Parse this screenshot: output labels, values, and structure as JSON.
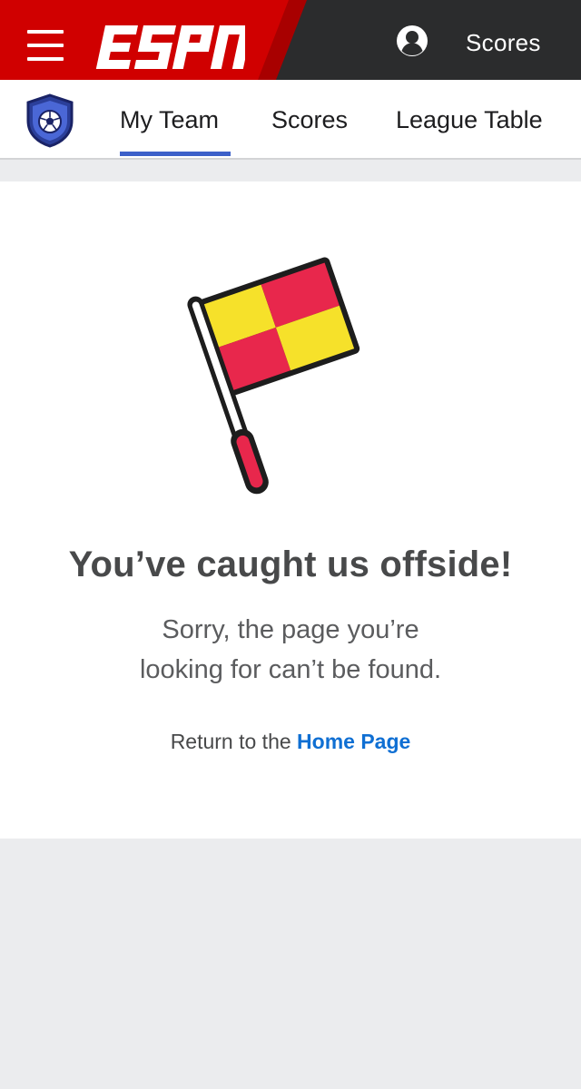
{
  "header": {
    "brand": "ESPN",
    "scores_label": "Scores",
    "brand_color": "#d00000",
    "background": "#2b2c2d",
    "icons": {
      "menu": "hamburger-menu-icon",
      "account": "account-avatar-icon"
    }
  },
  "subnav": {
    "tabs": [
      {
        "label": "My Team",
        "selected": true
      },
      {
        "label": "Scores",
        "selected": false
      },
      {
        "label": "League Table",
        "selected": false
      }
    ],
    "badge_icon": "soccer-ball-shield-icon",
    "accent_color": "#3c60c9"
  },
  "error": {
    "illustration": "offside-flag-icon",
    "headline": "You’ve caught us offside!",
    "message_line1": "Sorry, the page you’re",
    "message_line2": "looking for can’t be found.",
    "return_prefix": "Return to the ",
    "return_link": "Home Page",
    "link_color": "#0f6fd3"
  }
}
